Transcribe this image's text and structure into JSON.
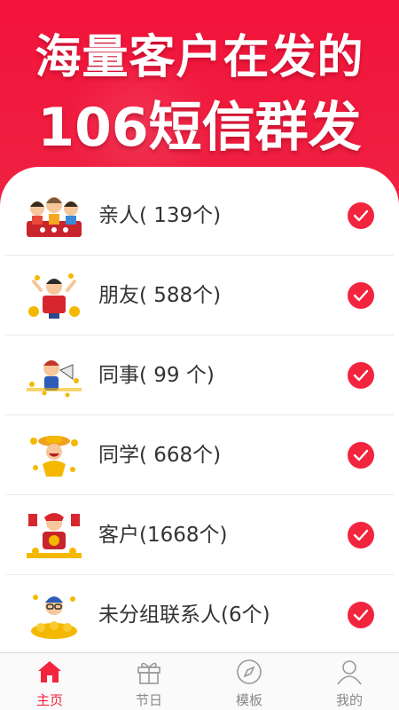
{
  "banner": {
    "line1": "海量客户在发的",
    "line2": "106短信群发"
  },
  "groups": [
    {
      "label": "亲人( 139个)",
      "icon": "family-illustration-icon",
      "selected": true
    },
    {
      "label": "朋友( 588个)",
      "icon": "friend-illustration-icon",
      "selected": true
    },
    {
      "label": "同事(  99 个)",
      "icon": "colleague-illustration-icon",
      "selected": true
    },
    {
      "label": "同学( 668个)",
      "icon": "classmate-illustration-icon",
      "selected": true
    },
    {
      "label": "客户(1668个)",
      "icon": "client-illustration-icon",
      "selected": true
    },
    {
      "label": "未分组联系人(6个)",
      "icon": "ungrouped-illustration-icon",
      "selected": true
    }
  ],
  "tabs": [
    {
      "label": "主页",
      "icon": "home-icon",
      "active": true
    },
    {
      "label": "节日",
      "icon": "gift-icon",
      "active": false
    },
    {
      "label": "模板",
      "icon": "compass-icon",
      "active": false
    },
    {
      "label": "我的",
      "icon": "user-icon",
      "active": false
    }
  ],
  "colors": {
    "accent": "#f2243e",
    "banner": "#f01c3f",
    "inactive_tab": "#888888"
  }
}
